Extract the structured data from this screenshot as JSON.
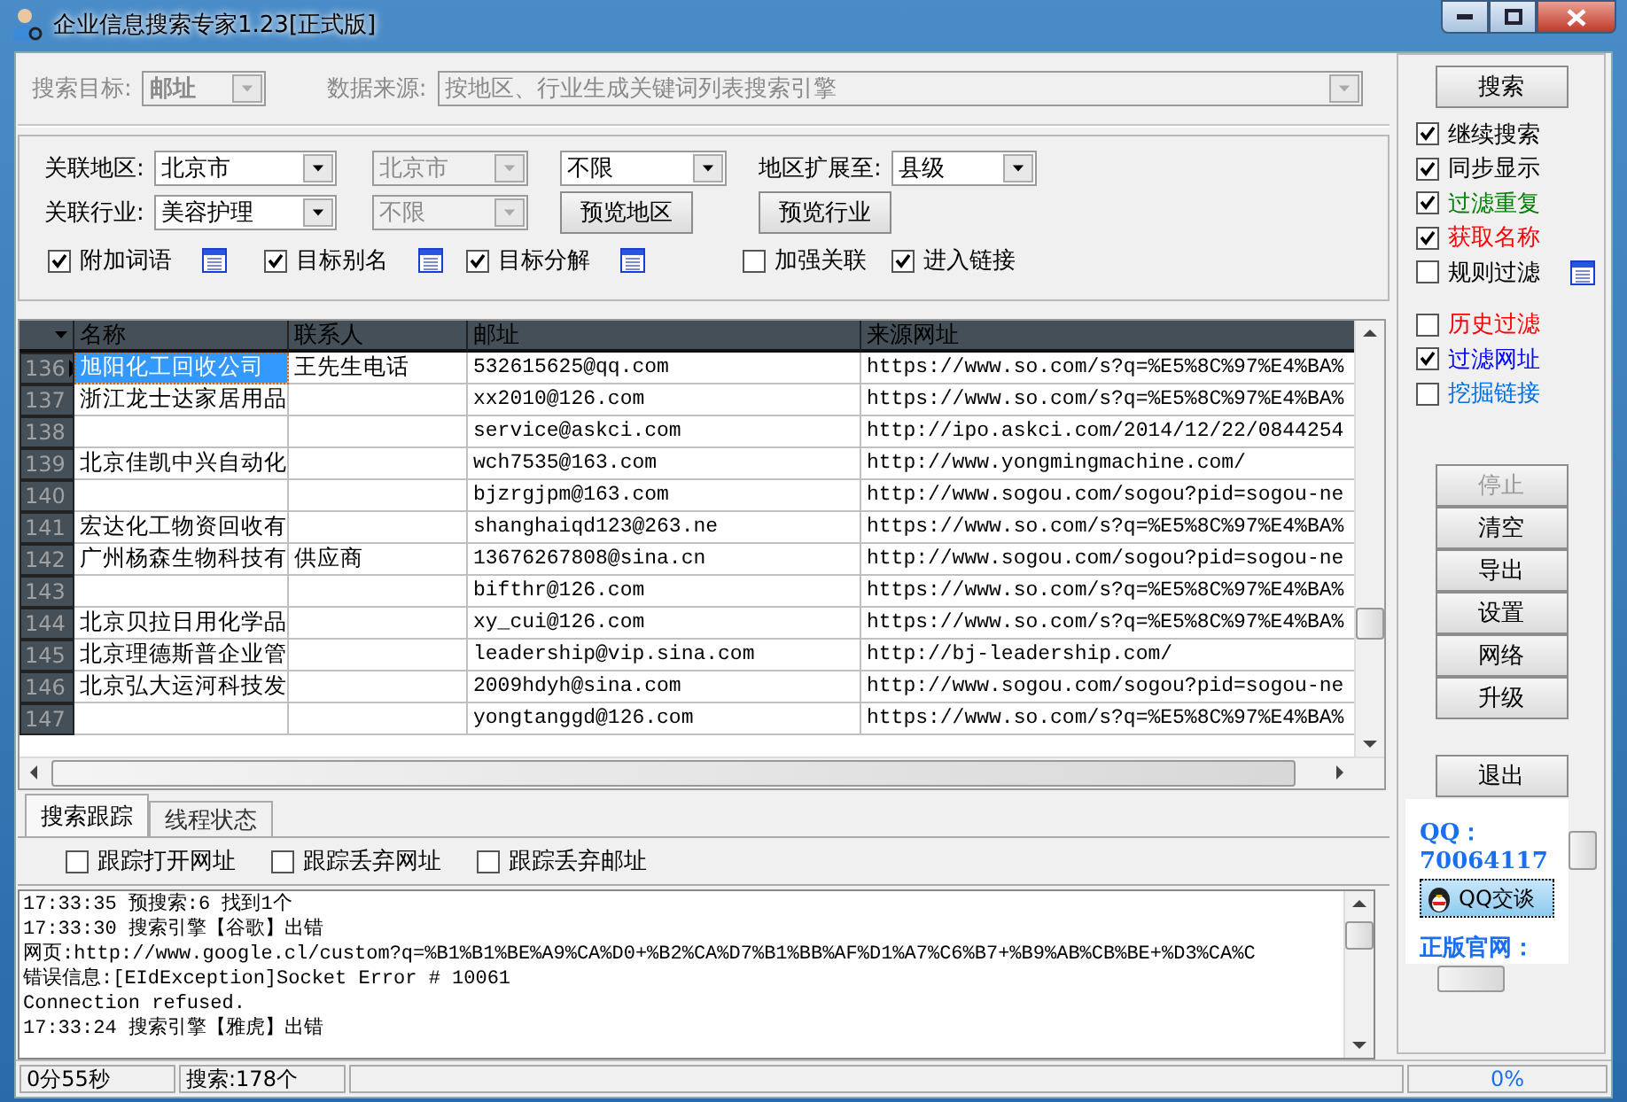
{
  "window": {
    "title": "企业信息搜索专家1.23[正式版]"
  },
  "search_target": {
    "label": "搜索目标:",
    "value": "邮址",
    "disabled": true
  },
  "data_source": {
    "label": "数据来源:",
    "value": "按地区、行业生成关键词列表搜索引擎",
    "disabled": true
  },
  "options": {
    "region_label": "关联地区:",
    "region": {
      "value": "北京市",
      "disabled": false
    },
    "region_sub": {
      "value": "北京市",
      "disabled": true
    },
    "region_limit": {
      "value": "不限",
      "disabled": false
    },
    "expand_label": "地区扩展至:",
    "expand": {
      "value": "县级",
      "disabled": false
    },
    "industry_label": "关联行业:",
    "industry": {
      "value": "美容护理",
      "disabled": false
    },
    "industry_sub": {
      "value": "不限",
      "disabled": true
    },
    "preview_buttons": [
      "预览地区",
      "预览行业"
    ],
    "checks": [
      {
        "label": "附加词语",
        "checked": true,
        "kind": "with_list"
      },
      {
        "label": "目标别名",
        "checked": true,
        "kind": "with_list"
      },
      {
        "label": "目标分解",
        "checked": true,
        "kind": "with_list"
      },
      {
        "label": "加强关联",
        "checked": false,
        "kind": "plain"
      },
      {
        "label": "进入链接",
        "checked": true,
        "kind": "plain"
      }
    ]
  },
  "table": {
    "columns": [
      "名称",
      "联系人",
      "邮址",
      "来源网址"
    ],
    "rows": [
      {
        "number": "136",
        "selected": true,
        "name": "旭阳化工回收公司",
        "contact": "王先生电话",
        "email": "532615625@qq.com",
        "source": "https://www.so.com/s?q=%E5%8C%97%E4%BA%"
      },
      {
        "number": "137",
        "selected": false,
        "name": "浙江龙士达家居用品",
        "email": "xx2010@126.com",
        "source": "https://www.so.com/s?q=%E5%8C%97%E4%BA%"
      },
      {
        "number": "138",
        "selected": false,
        "email": "service@askci.com",
        "source": "http://ipo.askci.com/2014/12/22/0844254"
      },
      {
        "number": "139",
        "selected": false,
        "name": "北京佳凯中兴自动化",
        "email": "wch7535@163.com",
        "source": "http://www.yongmingmachine.com/"
      },
      {
        "number": "140",
        "selected": false,
        "email": "bjzrgjpm@163.com",
        "source": "http://www.sogou.com/sogou?pid=sogou-ne"
      },
      {
        "number": "141",
        "selected": false,
        "name": "宏达化工物资回收有",
        "email": "shanghaiqd123@263.ne",
        "source": "https://www.so.com/s?q=%E5%8C%97%E4%BA%"
      },
      {
        "number": "142",
        "selected": false,
        "name": "广州杨森生物科技有",
        "contact": "供应商",
        "email": "13676267808@sina.cn",
        "source": "http://www.sogou.com/sogou?pid=sogou-ne"
      },
      {
        "number": "143",
        "selected": false,
        "email": "bifthr@126.com",
        "source": "https://www.so.com/s?q=%E5%8C%97%E4%BA%"
      },
      {
        "number": "144",
        "selected": false,
        "name": "北京贝拉日用化学品",
        "email": "xy_cui@126.com",
        "source": "https://www.so.com/s?q=%E5%8C%97%E4%BA%"
      },
      {
        "number": "145",
        "selected": false,
        "name": "北京理德斯普企业管",
        "email": "leadership@vip.sina.com",
        "source": "http://bj-leadership.com/"
      },
      {
        "number": "146",
        "selected": false,
        "name": "北京弘大运河科技发",
        "email": "2009hdyh@sina.com",
        "source": "http://www.sogou.com/sogou?pid=sogou-ne"
      },
      {
        "number": "147",
        "selected": false,
        "email": "yongtanggd@126.com",
        "source": "https://www.so.com/s?q=%E5%8C%97%E4%BA%"
      }
    ]
  },
  "tabs": [
    {
      "label": "搜索跟踪",
      "selected": true
    },
    {
      "label": "线程状态",
      "selected": false
    }
  ],
  "trace_checks": [
    {
      "label": "跟踪打开网址",
      "checked": false
    },
    {
      "label": "跟踪丢弃网址",
      "checked": false
    },
    {
      "label": "跟踪丢弃邮址",
      "checked": false
    }
  ],
  "log": [
    "17:33:35 预搜索:6 找到1个",
    "17:33:30 搜索引擎【谷歌】出错",
    "网页:http://www.google.cl/custom?q=%B1%B1%BE%A9%CA%D0+%B2%CA%D7%B1%BB%AF%D1%A7%C6%B7+%B9%AB%CB%BE+%D3%CA%C",
    "错误信息:[EIdException]Socket Error # 10061",
    "Connection refused.",
    "17:33:24 搜索引擎【雅虎】出错"
  ],
  "side": {
    "search_button": "搜索",
    "options": [
      {
        "label": "继续搜索",
        "checked": true,
        "color": "#000000",
        "kind": "plain"
      },
      {
        "label": "同步显示",
        "checked": true,
        "color": "#000000",
        "kind": "plain"
      },
      {
        "label": "过滤重复",
        "checked": true,
        "color": "#008000",
        "kind": "plain"
      },
      {
        "label": "获取名称",
        "checked": true,
        "color": "#ff0000",
        "kind": "plain"
      },
      {
        "label": "规则过滤",
        "checked": false,
        "color": "#000000",
        "kind": "with_list"
      }
    ],
    "filters": [
      {
        "label": "历史过滤",
        "checked": false,
        "color": "#ff0000"
      },
      {
        "label": "过滤网址",
        "checked": true,
        "color": "#0000ff"
      },
      {
        "label": "挖掘链接",
        "checked": false,
        "color": "#0070e0"
      }
    ],
    "buttons": [
      {
        "label": "停止",
        "disabled": true
      },
      {
        "label": "清空",
        "disabled": false
      },
      {
        "label": "导出",
        "disabled": false
      },
      {
        "label": "设置",
        "disabled": false
      },
      {
        "label": "网络",
        "disabled": false
      },
      {
        "label": "升级",
        "disabled": false
      }
    ],
    "exit_button": "退出",
    "contact": {
      "qq_label": "QQ：",
      "qq_number": "70064117",
      "chat_button": "QQ交谈",
      "site_label": "正版官网："
    }
  },
  "status_bar": {
    "elapsed": "0分55秒",
    "searched": "搜索:178个",
    "progress": "0%"
  }
}
